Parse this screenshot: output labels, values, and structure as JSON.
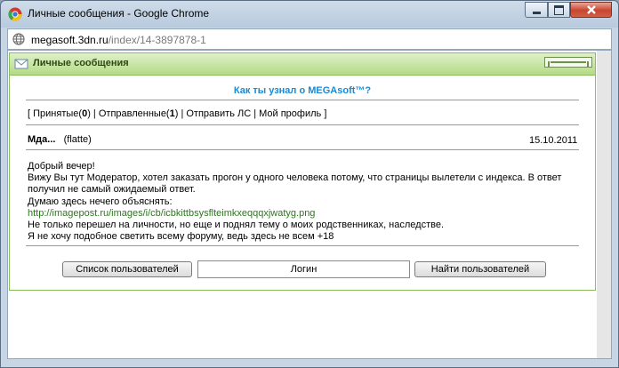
{
  "window": {
    "title": "Личные сообщения - Google Chrome",
    "url_host": "megasoft.3dn.ru",
    "url_path": "/index/14-3897878-1"
  },
  "panel": {
    "title": "Личные сообщения",
    "subject": "Как ты узнал о MEGAsoft™?",
    "nav": {
      "open_bracket": "[ ",
      "inbox_label": "Принятые(",
      "inbox_count": "0",
      "inbox_close": ")",
      "sep1": " | ",
      "sent_label": "Отправленные(",
      "sent_count": "1",
      "sent_close": ")",
      "sep2": " | ",
      "send_label": "Отправить ЛС",
      "sep3": " | ",
      "profile_label": "Мой профиль",
      "close_bracket": " ]"
    },
    "message": {
      "sender": "Мда...",
      "sender_login": "(flatte)",
      "date": "15.10.2011",
      "lines": [
        "Добрый вечер!",
        "Вижу Вы тут Модератор, хотел заказать прогон у одного человека потому, что страницы вылетели с индекса. В ответ",
        "получил не самый ожидаемый ответ.",
        "Думаю здесь нечего объяснять:"
      ],
      "link": "http://imagepost.ru/images/i/cb/icbkittbsysflteimkxeqqqxjwatyg.png",
      "lines_after": [
        "Не только перешел на личности, но еще и поднял тему о моих родственниках, наследстве.",
        "Я не хочу подобное светить всему форуму, ведь здесь не всем +18"
      ]
    },
    "buttons": {
      "user_list": "Список пользователей",
      "login_value": "Логин",
      "find_users": "Найти пользователей"
    }
  },
  "colors": {
    "subject_link": "#1a8ad4",
    "header_green": "#b4db86",
    "message_link": "#2a7a1a"
  }
}
